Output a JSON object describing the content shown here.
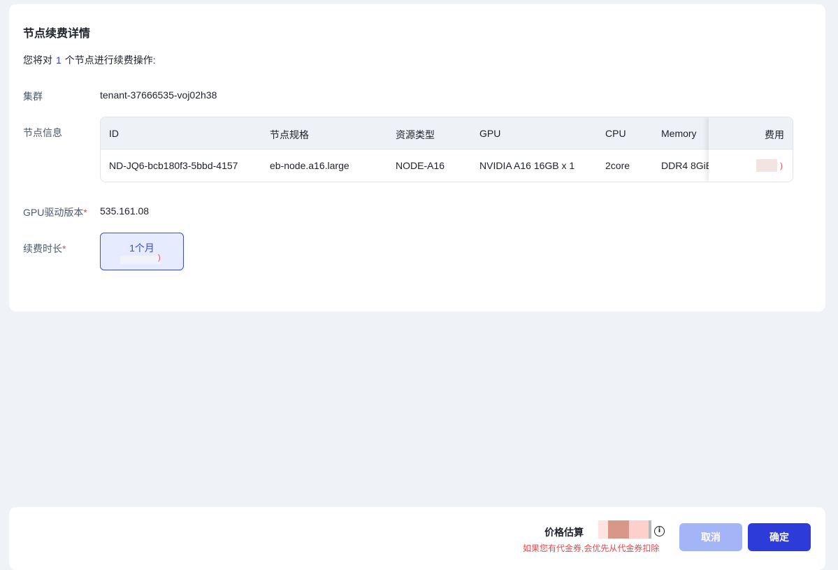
{
  "page": {
    "title": "节点续费详情",
    "intro_prefix": "您将对",
    "intro_count": "1",
    "intro_suffix": "个节点进行续费操作:"
  },
  "cluster": {
    "label": "集群",
    "value": "tenant-37666535-voj02h38"
  },
  "node_info": {
    "label": "节点信息",
    "columns": [
      "ID",
      "节点规格",
      "资源类型",
      "GPU",
      "CPU",
      "Memory",
      "费用"
    ],
    "rows": [
      {
        "id": "ND-JQ6-bcb180f3-5bbd-4157",
        "spec": "eb-node.a16.large",
        "resource_type": "NODE-A16",
        "gpu": "NVIDIA A16 16GB x 1",
        "cpu": "2core",
        "memory": "DDR4 8GiB",
        "fee_suffix": ")"
      }
    ]
  },
  "gpu_driver": {
    "label": "GPU驱动版本",
    "required_mark": "*",
    "value": "535.161.08"
  },
  "duration": {
    "label": "续费时长",
    "required_mark": "*",
    "options": [
      {
        "label": "1个月",
        "price_suffix": ")",
        "selected": true
      }
    ]
  },
  "footer": {
    "price_label": "价格估算",
    "info_icon": "i",
    "voucher_note": "如果您有代金券,会优先从代金券扣除",
    "cancel_label": "取消",
    "confirm_label": "确定"
  },
  "colors": {
    "accent": "#2d3bd8",
    "accent_light": "#a3b5f6",
    "danger": "#e5484d",
    "background": "#eff2f7"
  }
}
